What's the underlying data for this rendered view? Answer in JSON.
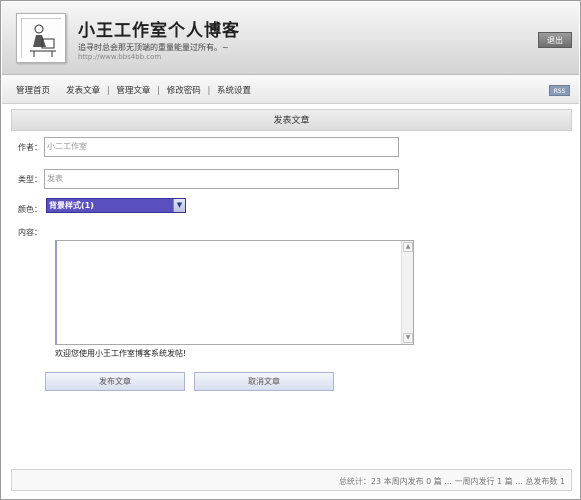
{
  "header": {
    "title": "小王工作室个人博客",
    "slogan": "追寻时总会那无顶端的重量能量过所有。~",
    "url": "http://www.bbs4bb.com",
    "logout_label": "退出"
  },
  "nav": {
    "items": [
      {
        "label": "管理首页"
      },
      {
        "label": "发表文章"
      },
      {
        "label": "管理文章"
      },
      {
        "label": "修改密码"
      },
      {
        "label": "系统设置"
      }
    ],
    "rss_label": "RSS"
  },
  "panel": {
    "title": "发表文章"
  },
  "form": {
    "author_label": "作者：",
    "author_value": "小二工作室",
    "type_label": "类型：",
    "type_value": "发表",
    "color_label": "颜色：",
    "color_selected": "背景样式(1)",
    "content_label": "内容：",
    "content_value": "",
    "hint": "欢迎您使用小王工作室博客系统发帖!",
    "submit_label": "发布文章",
    "cancel_label": "取消文章"
  },
  "footer": {
    "stats": "总统计：23 本周内发布 0 篇 ... 一周内发行 1 篇 ... 总发布数 1"
  },
  "colors": {
    "select_bg": "#5a4fbf",
    "logout_bg": "#6d6d6d",
    "rss_bg": "#8a9bb5"
  }
}
